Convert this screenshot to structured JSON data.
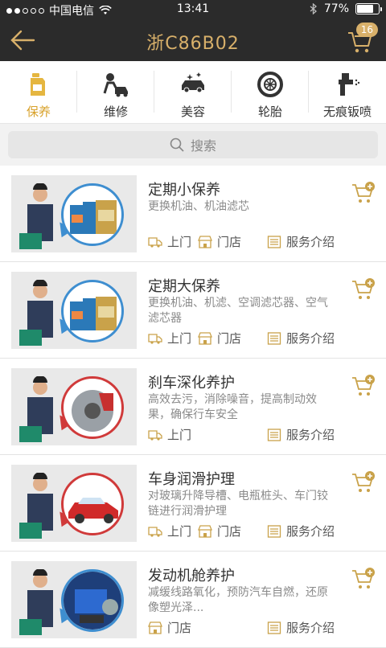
{
  "statusbar": {
    "carrier": "中国电信",
    "time": "13:41",
    "battery": "77%",
    "battery_level": 0.77
  },
  "navbar": {
    "title": "浙C86B02",
    "cart_count": "16"
  },
  "tabs": [
    {
      "label": "保养",
      "icon": "oil-bottle-icon",
      "active": true
    },
    {
      "label": "维修",
      "icon": "mechanic-icon",
      "active": false
    },
    {
      "label": "美容",
      "icon": "car-sparkle-icon",
      "active": false
    },
    {
      "label": "轮胎",
      "icon": "tire-icon",
      "active": false
    },
    {
      "label": "无痕钣喷",
      "icon": "spray-gun-icon",
      "active": false
    }
  ],
  "search": {
    "placeholder": "搜索"
  },
  "services": [
    {
      "title": "定期小保养",
      "desc": "更换机油、机油滤芯",
      "actions": [
        "上门",
        "门店",
        "服务介绍"
      ],
      "image": "oil-bottles"
    },
    {
      "title": "定期大保养",
      "desc": "更换机油、机滤、空调滤芯器、空气滤芯器",
      "actions": [
        "上门",
        "门店",
        "服务介绍"
      ],
      "image": "oil-bottles"
    },
    {
      "title": "刹车深化养护",
      "desc": "高效去污，消除噪音，提高制动效果，确保行车安全",
      "actions": [
        "上门",
        "服务介绍"
      ],
      "image": "brake-disc"
    },
    {
      "title": "车身润滑护理",
      "desc": "对玻璃升降导槽、电瓶桩头、车门铰链进行润滑护理",
      "actions": [
        "上门",
        "门店",
        "服务介绍"
      ],
      "image": "red-car"
    },
    {
      "title": "发动机舱养护",
      "desc": "减缓线路氧化，预防汽车自燃，还原像塑光泽...",
      "actions": [
        "门店",
        "服务介绍"
      ],
      "image": "engine-bay"
    }
  ],
  "colors": {
    "accent": "#d8a12a",
    "dark": "#2b2b2b",
    "gold": "#d8b06a"
  }
}
